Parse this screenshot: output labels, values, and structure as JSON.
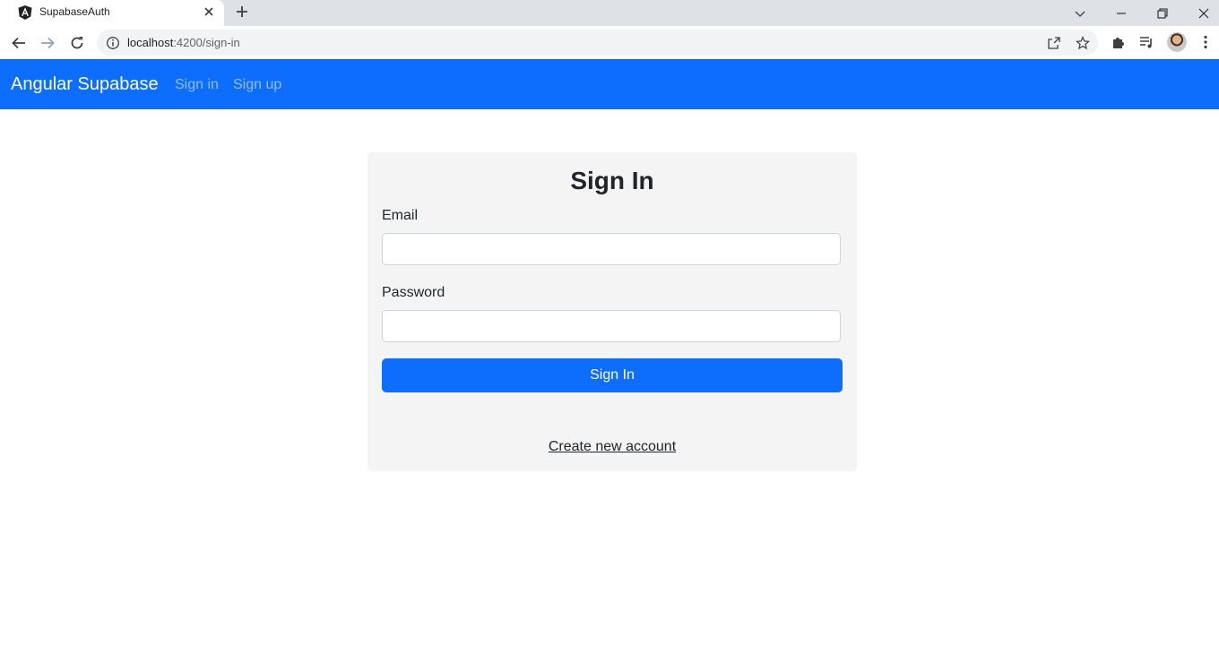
{
  "browser": {
    "tab_title": "SupabaseAuth",
    "url_host": "localhost",
    "url_rest": ":4200/sign-in"
  },
  "navbar": {
    "brand": "Angular Supabase",
    "links": [
      "Sign in",
      "Sign up"
    ],
    "background": "#0d6efd"
  },
  "form": {
    "title": "Sign In",
    "email_label": "Email",
    "email_value": "",
    "password_label": "Password",
    "password_value": "",
    "submit_label": "Sign In",
    "create_account_link": "Create new account"
  },
  "icons": {
    "favicon": "angular-logo-icon",
    "tab_close": "close-icon",
    "new_tab": "plus-icon",
    "back": "arrow-left-icon",
    "forward": "arrow-right-icon",
    "reload": "reload-icon",
    "site_info": "info-icon",
    "share": "share-icon",
    "bookmark": "star-icon",
    "extensions": "puzzle-icon",
    "media": "media-queue-icon",
    "menu": "kebab-menu-icon"
  }
}
